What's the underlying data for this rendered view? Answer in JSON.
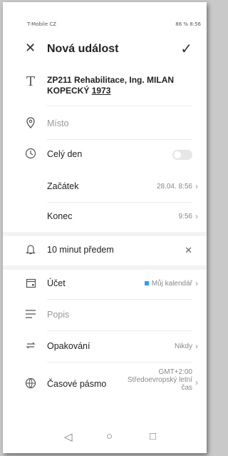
{
  "status": {
    "carrier": "T-Mobile CZ",
    "right": "86 % 8:56"
  },
  "header": {
    "title": "Nová událost"
  },
  "event": {
    "title_main": "ZP211 Rehabilitace, Ing. MILAN KOPECKÝ ",
    "title_link": "1973"
  },
  "location": {
    "placeholder": "Místo"
  },
  "allday": {
    "label": "Celý den",
    "enabled": false
  },
  "start": {
    "label": "Začátek",
    "value": "28.04. 8:56"
  },
  "end": {
    "label": "Konec",
    "value": "9:56"
  },
  "reminder": {
    "label": "10 minut předem"
  },
  "account": {
    "label": "Účet",
    "value": "Můj kalendář"
  },
  "description": {
    "placeholder": "Popis"
  },
  "repeat": {
    "label": "Opakování",
    "value": "Nikdy"
  },
  "timezone": {
    "label": "Časové pásmo",
    "value_line1": "GMT+2:00",
    "value_line2": "Středoevropský letní",
    "value_line3": "čas"
  },
  "colors": {
    "accent": "#2a9df4"
  }
}
